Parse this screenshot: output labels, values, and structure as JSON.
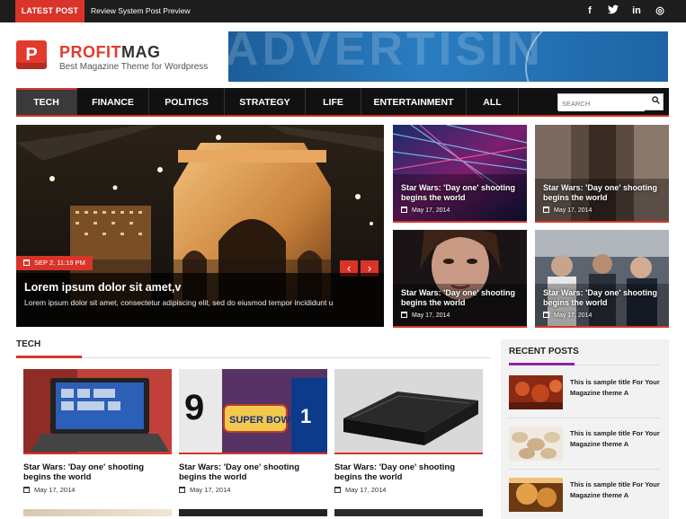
{
  "topbar": {
    "latest_label": "LATEST POST",
    "latest_title": "Review System Post Preview",
    "social": [
      {
        "name": "facebook-icon",
        "glyph": "f"
      },
      {
        "name": "twitter-icon",
        "glyph": "t"
      },
      {
        "name": "linkedin-icon",
        "glyph": "in"
      },
      {
        "name": "dribbble-icon",
        "glyph": "◎"
      }
    ]
  },
  "brand": {
    "logo_letter": "P",
    "name_part1": "PROFIT",
    "name_part2": "MAG",
    "tagline": "Best Magazine Theme for Wordpress",
    "accent": "#e23b2e"
  },
  "ad": {
    "text": "ADVERTISIN"
  },
  "nav": {
    "items": [
      {
        "label": "TECH",
        "active": true
      },
      {
        "label": "FINANCE",
        "active": false
      },
      {
        "label": "POLITICS",
        "active": false
      },
      {
        "label": "STRATEGY",
        "active": false
      },
      {
        "label": "LIFE",
        "active": false
      },
      {
        "label": "ENTERTAINMENT",
        "active": false
      },
      {
        "label": "ALL",
        "active": false
      }
    ],
    "search_placeholder": "SEARCH"
  },
  "hero": {
    "date": "SEP 2, 11:19 PM",
    "title": "Lorem ipsum dolor sit amet,v",
    "excerpt": "Lorem ipsum dolor sit amet, consectetur adipiscing elit, sed do eiusmod tempor incididunt u",
    "prev": "‹",
    "next": "›"
  },
  "tiles": [
    {
      "title": "Star Wars: 'Day one' shooting begins the world",
      "date": "May 17, 2014"
    },
    {
      "title": "Star Wars: 'Day one' shooting begins the world",
      "date": "May 17, 2014"
    },
    {
      "title": "Star Wars: 'Day one' shooting begins the world",
      "date": "May 17, 2014"
    },
    {
      "title": "Star Wars: 'Day one' shooting begins the world",
      "date": "May 17, 2014"
    }
  ],
  "tech": {
    "heading": "TECH",
    "cards": [
      {
        "title": "Star Wars: 'Day one' shooting begins the world",
        "date": "May 17, 2014"
      },
      {
        "title": "Star Wars: 'Day one' shooting begins the world",
        "date": "May 17, 2014"
      },
      {
        "title": "Star Wars: 'Day one' shooting begins the world",
        "date": "May 17, 2014"
      }
    ]
  },
  "sidebar": {
    "heading": "RECENT POSTS",
    "accent": "#8e24aa",
    "posts": [
      {
        "title": "This is sample title For Your Magazine theme A"
      },
      {
        "title": "This is sample title For Your Magazine theme A"
      },
      {
        "title": "This is sample title For Your Magazine theme A"
      }
    ]
  }
}
